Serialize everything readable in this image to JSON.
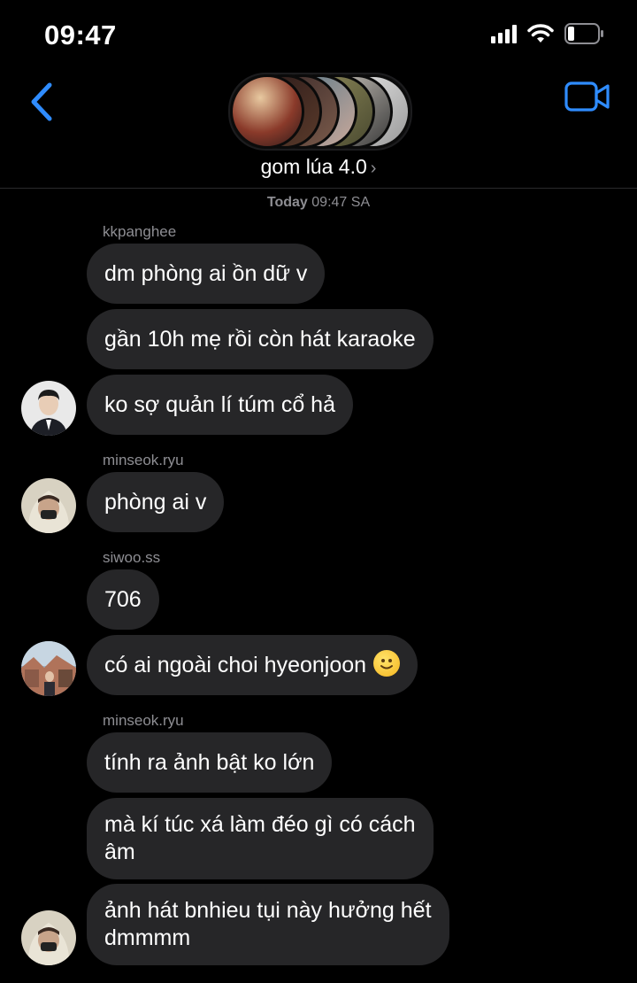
{
  "status_bar": {
    "time": "09:47"
  },
  "header": {
    "title": "gom lúa 4.0",
    "title_chevron": "›",
    "back_icon": "chevron-left-icon",
    "video_icon": "video-camera-icon",
    "accent_color": "#2f8cff"
  },
  "timestamp": {
    "day": "Today",
    "time": "09:47 SA"
  },
  "messages": [
    {
      "sender": "kkpanghee",
      "text": "dm phòng ai ồn dữ v"
    },
    {
      "text": "gần 10h mẹ rồi còn hát karaoke"
    },
    {
      "text": "ko sợ quản lí túm cổ hả"
    },
    {
      "sender": "minseok.ryu",
      "text": "phòng ai v"
    },
    {
      "sender": "siwoo.ss",
      "text": "706"
    },
    {
      "text": "có ai ngoài choi hyeonjoon",
      "emoji": "slightly-smiling-face"
    },
    {
      "sender": "minseok.ryu",
      "text": "tính ra ảnh bật ko lớn"
    },
    {
      "text": "mà kí túc xá làm đéo gì có cách\nâm"
    },
    {
      "text": "ảnh hát bnhieu tụi này hưởng hết\ndmmmm"
    }
  ]
}
